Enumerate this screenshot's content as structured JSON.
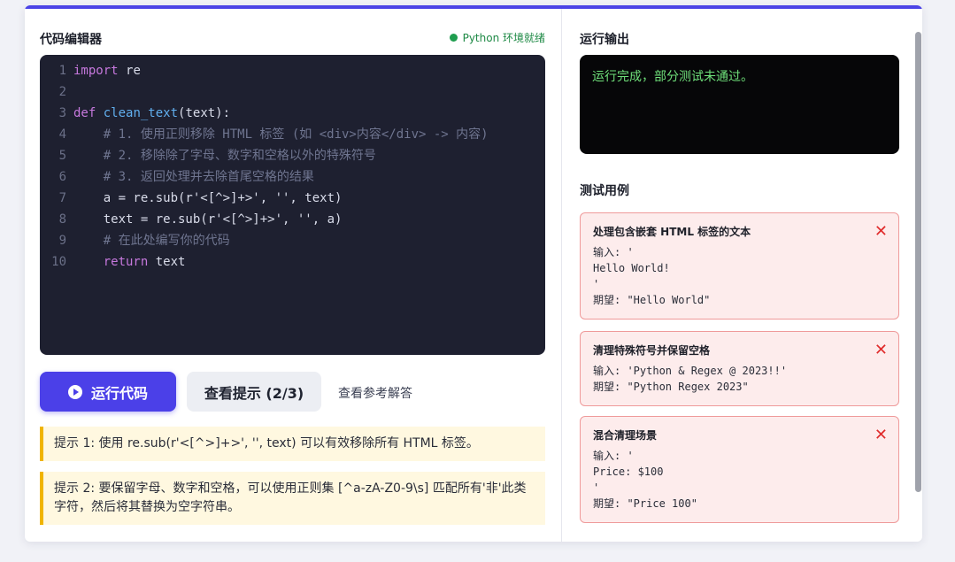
{
  "editor": {
    "title": "代码编辑器",
    "env_status": "Python 环境就绪",
    "lines": [
      {
        "no": "1",
        "html": "<span class='kw'>import</span> <span class='plain'>re</span>"
      },
      {
        "no": "2",
        "html": ""
      },
      {
        "no": "3",
        "html": "<span class='kw'>def</span> <span class='fn'>clean_text</span><span class='plain'>(text):</span>"
      },
      {
        "no": "4",
        "html": "    <span class='cmt'># 1. 使用正则移除 HTML 标签 (如 &lt;div&gt;内容&lt;/div&gt; -&gt; 内容)</span>"
      },
      {
        "no": "5",
        "html": "    <span class='cmt'># 2. 移除除了字母、数字和空格以外的特殊符号</span>"
      },
      {
        "no": "6",
        "html": "    <span class='cmt'># 3. 返回处理并去除首尾空格的结果</span>"
      },
      {
        "no": "7",
        "html": "    <span class='plain'>a = re.sub(r'&lt;[^&gt;]+&gt;', '', text)</span>"
      },
      {
        "no": "8",
        "html": "    <span class='plain'>text = re.sub(r'&lt;[^&gt;]+&gt;', '', a)</span>"
      },
      {
        "no": "9",
        "html": "    <span class='cmt'># 在此处编写你的代码</span>"
      },
      {
        "no": "10",
        "html": "    <span class='kw'>return</span> <span class='plain'>text</span>"
      }
    ]
  },
  "actions": {
    "run_label": "运行代码",
    "hint_label": "查看提示 (2/3)",
    "solution_label": "查看参考解答"
  },
  "hints": [
    "提示 1: 使用 re.sub(r'<[^>]+>', '', text) 可以有效移除所有 HTML 标签。",
    "提示 2: 要保留字母、数字和空格，可以使用正则集 [^a-zA-Z0-9\\s] 匹配所有'非'此类字符，然后将其替换为空字符串。"
  ],
  "output": {
    "title": "运行输出",
    "text": "运行完成，部分测试未通过。"
  },
  "tests": {
    "title": "测试用例",
    "cases": [
      {
        "name": "处理包含嵌套 HTML 标签的文本",
        "lines": [
          "输入: '",
          "Hello World!",
          "'",
          "期望: \"Hello World\""
        ]
      },
      {
        "name": "清理特殊符号并保留空格",
        "lines": [
          "输入: 'Python & Regex @ 2023!!'",
          "期望: \"Python Regex 2023\""
        ]
      },
      {
        "name": "混合清理场景",
        "lines": [
          "输入: '",
          "Price: $100",
          "'",
          "期望: \"Price 100\""
        ]
      }
    ],
    "fail_symbol": "✕"
  },
  "colors": {
    "accent": "#4b40e8",
    "success": "#1f9d4f",
    "fail": "#e02b2b"
  }
}
